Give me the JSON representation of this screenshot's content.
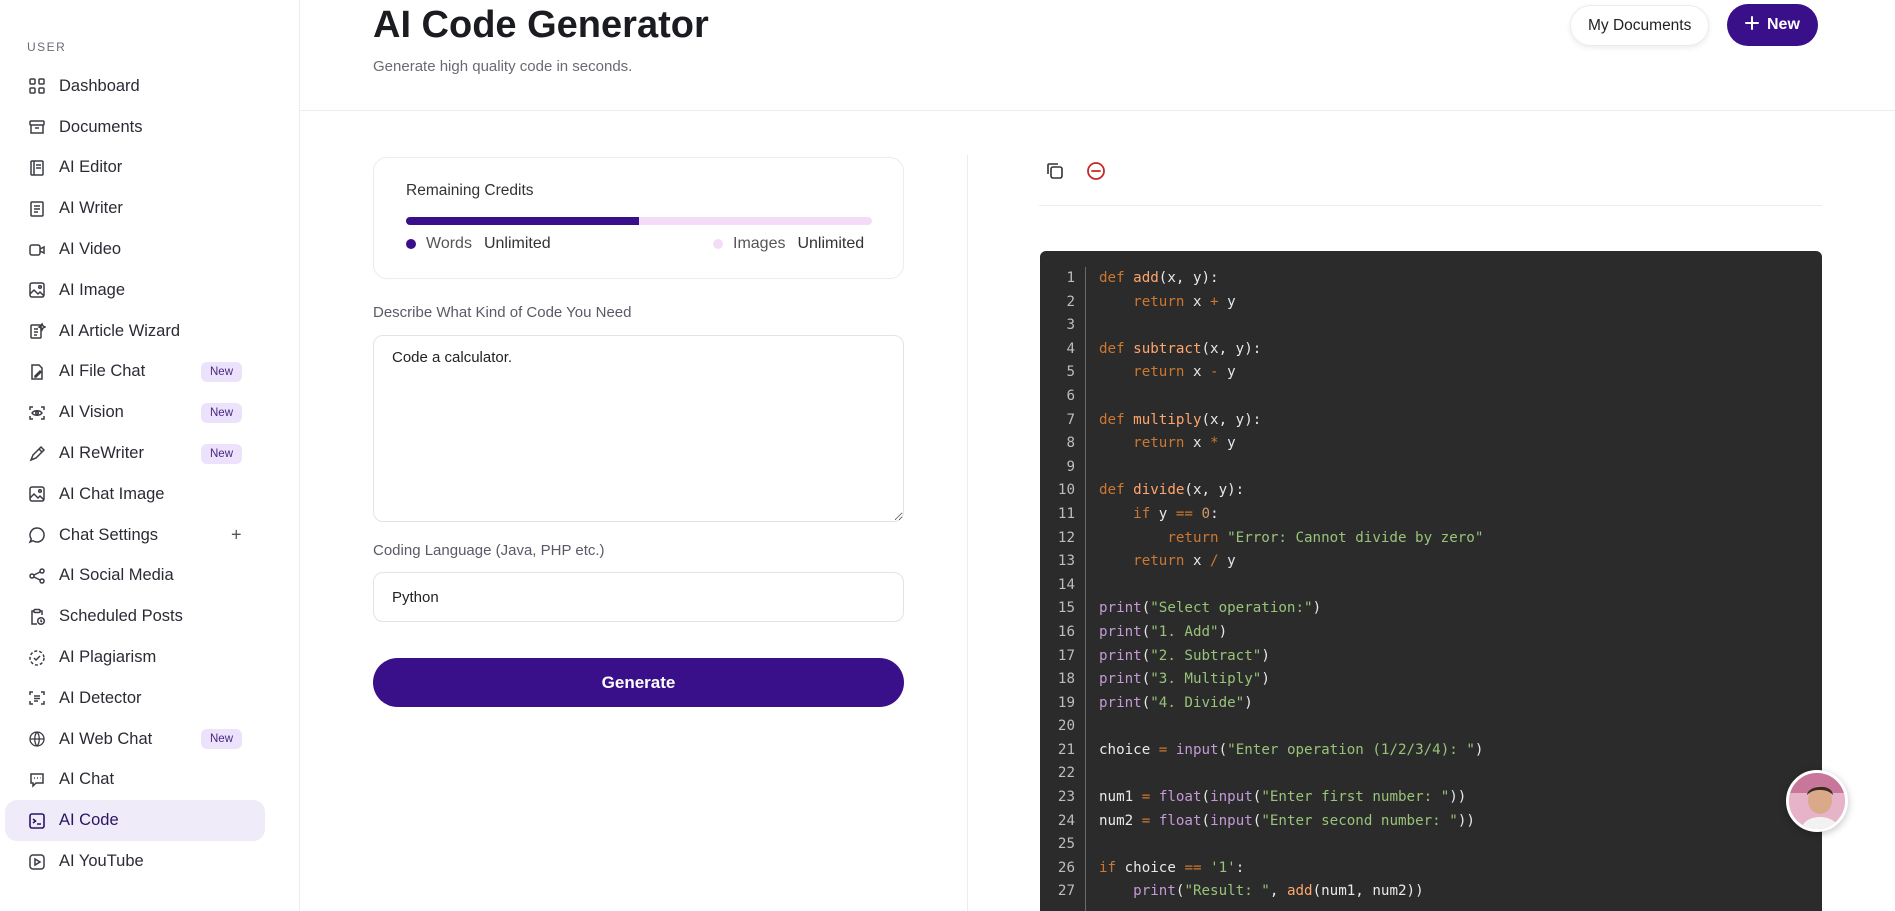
{
  "sidebar": {
    "section_label": "USER",
    "items": [
      {
        "label": "Dashboard",
        "icon": "grid-icon"
      },
      {
        "label": "Documents",
        "icon": "archive-icon"
      },
      {
        "label": "AI Editor",
        "icon": "book-icon"
      },
      {
        "label": "AI Writer",
        "icon": "document-icon"
      },
      {
        "label": "AI Video",
        "icon": "video-icon"
      },
      {
        "label": "AI Image",
        "icon": "image-icon"
      },
      {
        "label": "AI Article Wizard",
        "icon": "wizard-icon"
      },
      {
        "label": "AI File Chat",
        "icon": "file-edit-icon",
        "badge": "New"
      },
      {
        "label": "AI Vision",
        "icon": "scan-eye-icon",
        "badge": "New"
      },
      {
        "label": "AI ReWriter",
        "icon": "pen-icon",
        "badge": "New"
      },
      {
        "label": "AI Chat Image",
        "icon": "image-icon"
      },
      {
        "label": "Chat Settings",
        "icon": "chat-bubble-icon",
        "plus": "+"
      },
      {
        "label": "AI Social Media",
        "icon": "share-icon"
      },
      {
        "label": "Scheduled Posts",
        "icon": "clipboard-clock-icon"
      },
      {
        "label": "AI Plagiarism",
        "icon": "check-circle-dashed-icon"
      },
      {
        "label": "AI Detector",
        "icon": "scan-text-icon"
      },
      {
        "label": "AI Web Chat",
        "icon": "globe-www-icon",
        "badge": "New"
      },
      {
        "label": "AI Chat",
        "icon": "chat-square-icon"
      },
      {
        "label": "AI Code",
        "icon": "terminal-icon",
        "active": true
      },
      {
        "label": "AI YouTube",
        "icon": "play-square-icon"
      }
    ]
  },
  "header": {
    "title": "AI Code Generator",
    "subtitle": "Generate high quality code in seconds.",
    "my_documents_label": "My Documents",
    "new_label": "New"
  },
  "credits": {
    "title": "Remaining Credits",
    "progress_fraction": 0.5,
    "words_label": "Words",
    "words_value": "Unlimited",
    "images_label": "Images",
    "images_value": "Unlimited",
    "colors": {
      "words": "#3a0f8a",
      "images": "#f2dcf6"
    }
  },
  "form": {
    "description_label": "Describe What Kind of Code You Need",
    "description_value": "Code a calculator.",
    "language_label": "Coding Language (Java, PHP etc.)",
    "language_value": "Python",
    "generate_label": "Generate"
  },
  "output": {
    "copy_icon": "copy-icon",
    "clear_icon": "minus-circle-icon",
    "code_lines": [
      "def add(x, y):",
      "    return x + y",
      "",
      "def subtract(x, y):",
      "    return x - y",
      "",
      "def multiply(x, y):",
      "    return x * y",
      "",
      "def divide(x, y):",
      "    if y == 0:",
      "        return \"Error: Cannot divide by zero\"",
      "    return x / y",
      "",
      "print(\"Select operation:\")",
      "print(\"1. Add\")",
      "print(\"2. Subtract\")",
      "print(\"3. Multiply\")",
      "print(\"4. Divide\")",
      "",
      "choice = input(\"Enter operation (1/2/3/4): \")",
      "",
      "num1 = float(input(\"Enter first number: \"))",
      "num2 = float(input(\"Enter second number: \"))",
      "",
      "if choice == '1':",
      "    print(\"Result: \", add(num1, num2))"
    ]
  },
  "theme": {
    "accent": "#3a0f8a",
    "code_bg": "#2b2b2b"
  }
}
